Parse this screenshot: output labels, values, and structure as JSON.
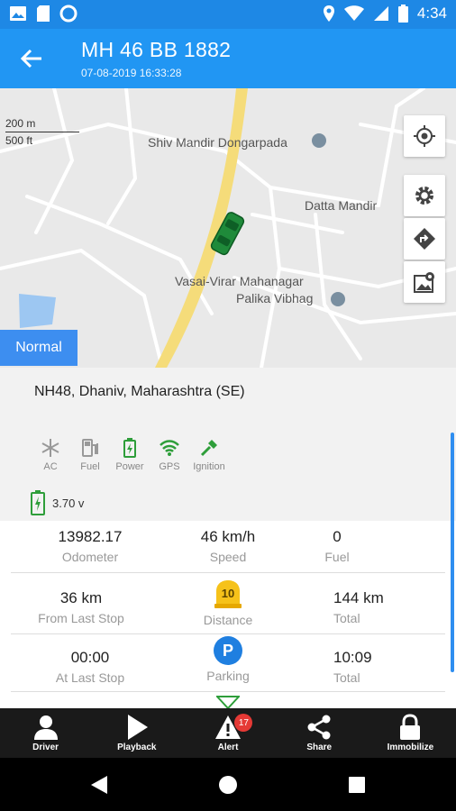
{
  "status_bar": {
    "time": "4:34"
  },
  "app_bar": {
    "title": "MH 46 BB 1882",
    "subtitle": "07-08-2019 16:33:28"
  },
  "map": {
    "scale_top": "200 m",
    "scale_bottom": "500 ft",
    "labels": [
      "Shiv Mandir Dongarpada",
      "Datta Mandir",
      "Vasai-Virar Mahanagar",
      "Palika Vibhag"
    ],
    "mode_button": "Normal"
  },
  "address": "NH48,  Dhaniv, Maharashtra (SE)",
  "status_icons": [
    {
      "label": "AC",
      "icon": "snowflake-icon",
      "color": "#999999"
    },
    {
      "label": "Fuel",
      "icon": "fuel-pump-icon",
      "color": "#999999"
    },
    {
      "label": "Power",
      "icon": "battery-icon",
      "color": "#2e9e3a"
    },
    {
      "label": "GPS",
      "icon": "wifi-icon",
      "color": "#2e9e3a"
    },
    {
      "label": "Ignition",
      "icon": "key-icon",
      "color": "#2e9e3a"
    }
  ],
  "battery": {
    "voltage": "3.70 v"
  },
  "stats": {
    "odometer": {
      "value": "13982.17",
      "label": "Odometer"
    },
    "speed": {
      "value": "46 km/h",
      "label": "Speed"
    },
    "fuel": {
      "value": "0",
      "label": "Fuel"
    },
    "from_last_stop": {
      "value": "36 km",
      "label": "From Last Stop"
    },
    "distance": {
      "badge": "10",
      "label": "Distance"
    },
    "total_distance": {
      "value": "144 km",
      "label": "Total"
    },
    "at_last_stop": {
      "value": "00:00",
      "label": "At Last Stop"
    },
    "parking": {
      "badge": "P",
      "label": "Parking"
    },
    "total_time": {
      "value": "10:09",
      "label": "Total"
    }
  },
  "bottom_nav": [
    {
      "label": "Driver",
      "icon": "driver-icon"
    },
    {
      "label": "Playback",
      "icon": "play-icon"
    },
    {
      "label": "Alert",
      "icon": "alert-icon",
      "badge": "17"
    },
    {
      "label": "Share",
      "icon": "share-icon"
    },
    {
      "label": "Immobilize",
      "icon": "lock-icon"
    }
  ],
  "colors": {
    "primary": "#2196f3",
    "status_bar": "#1e88e5",
    "ok_green": "#2e9e3a",
    "accent_blue": "#3d8ef0"
  }
}
